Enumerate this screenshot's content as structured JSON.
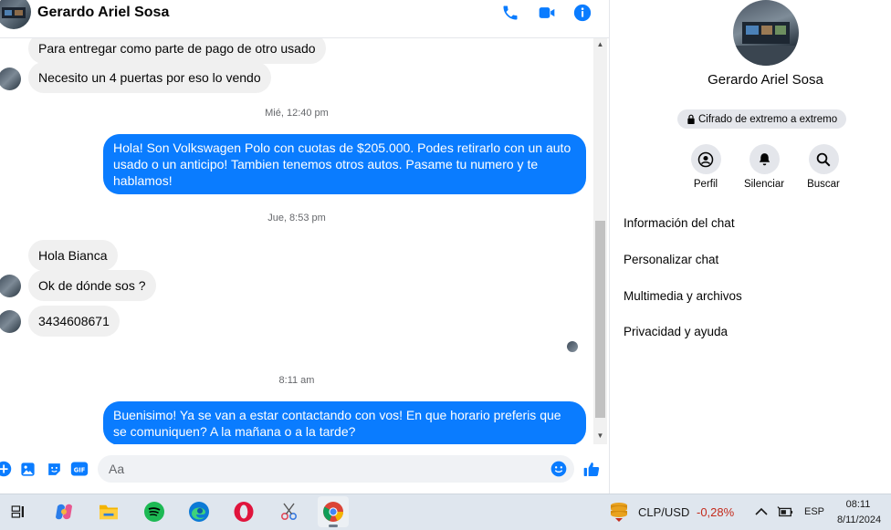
{
  "header": {
    "contact_name": "Gerardo Ariel Sosa"
  },
  "messages": {
    "in_1": "Para entregar como parte de pago de otro usado",
    "in_2": "Necesito un 4 puertas por eso lo vendo",
    "ts_1": "Mié, 12:40 pm",
    "out_1": "Hola! Son Volkswagen Polo con cuotas de $205.000. Podes retirarlo con un auto usado o un anticipo! Tambien tenemos otros autos. Pasame tu numero y te hablamos!",
    "ts_2": "Jue, 8:53 pm",
    "in_3": "Hola Bianca",
    "in_4": "Ok de dónde sos ?",
    "in_5": "3434608671",
    "ts_3": "8:11 am",
    "out_2": "Buenisimo! Ya se van a estar contactando con vos! En que horario preferis que se comuniquen? A la mañana o a la tarde?"
  },
  "composer": {
    "placeholder": "Aa"
  },
  "panel": {
    "name": "Gerardo Ariel Sosa",
    "encryption": "Cifrado de extremo a extremo",
    "actions": {
      "profile": "Perfil",
      "mute": "Silenciar",
      "search": "Buscar"
    },
    "items": {
      "info": "Información del chat",
      "customize": "Personalizar chat",
      "media": "Multimedia y archivos",
      "privacy": "Privacidad y ayuda"
    }
  },
  "taskbar": {
    "stock_pair": "CLP/USD",
    "stock_change": "-0,28%",
    "language": "ESP",
    "time": "08:11",
    "date": "8/11/2024"
  },
  "colors": {
    "accent": "#0a7cff",
    "bubble_in": "#f0f0f0",
    "negative": "#c42b1c"
  }
}
